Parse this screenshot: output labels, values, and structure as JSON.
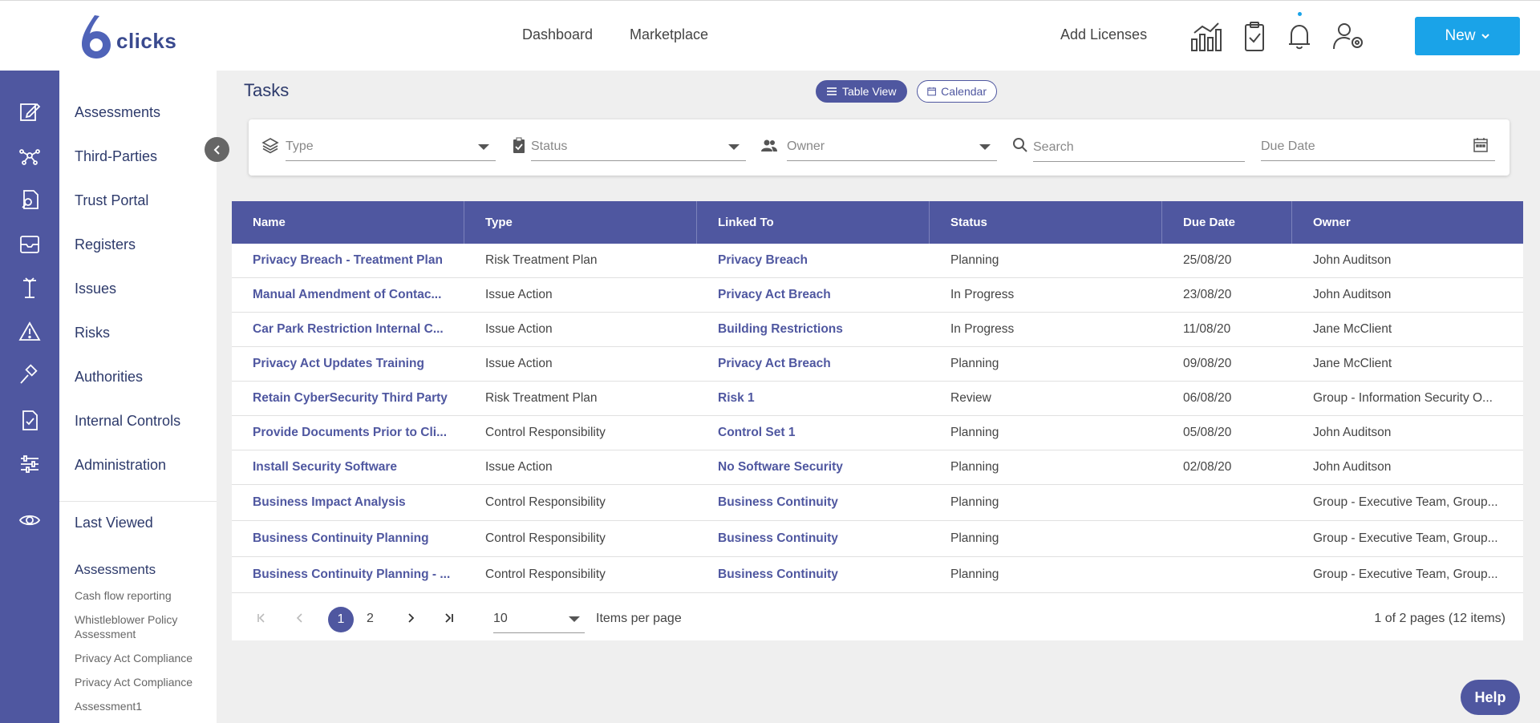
{
  "brand": {
    "logo_text": "clicks"
  },
  "topnav": {
    "dashboard": "Dashboard",
    "marketplace": "Marketplace",
    "add_licenses": "Add Licenses",
    "new_label": "New"
  },
  "colors": {
    "primary": "#4f57a0",
    "accent": "#1aa3e8"
  },
  "rail_icons": [
    "edit-icon",
    "network-icon",
    "file-search-icon",
    "inbox-icon",
    "antenna-icon",
    "warning-icon",
    "gavel-icon",
    "checklist-icon",
    "sliders-icon",
    "eye-icon"
  ],
  "sidebar": {
    "items": [
      "Assessments",
      "Third-Parties",
      "Trust Portal",
      "Registers",
      "Issues",
      "Risks",
      "Authorities",
      "Internal Controls",
      "Administration"
    ],
    "last_viewed": {
      "title": "Last Viewed",
      "section": "Assessments",
      "items": [
        "Cash flow reporting",
        "Whistleblower Policy Assessment",
        "Privacy Act Compliance",
        "Privacy Act Compliance",
        "Assessment1"
      ]
    }
  },
  "page": {
    "title": "Tasks",
    "views": {
      "table": "Table View",
      "calendar": "Calendar"
    }
  },
  "filters": {
    "type": "Type",
    "status": "Status",
    "owner": "Owner",
    "search": "Search",
    "due_date": "Due Date"
  },
  "table": {
    "headers": [
      "Name",
      "Type",
      "Linked To",
      "Status",
      "Due Date",
      "Owner"
    ],
    "rows": [
      [
        "Privacy Breach - Treatment Plan",
        "Risk Treatment Plan",
        "Privacy Breach",
        "Planning",
        "25/08/20",
        "John Auditson"
      ],
      [
        "Manual Amendment of Contac...",
        "Issue Action",
        "Privacy Act Breach",
        "In Progress",
        "23/08/20",
        "John Auditson"
      ],
      [
        "Car Park Restriction Internal C...",
        "Issue Action",
        "Building Restrictions",
        "In Progress",
        "11/08/20",
        "Jane McClient"
      ],
      [
        "Privacy Act Updates Training",
        "Issue Action",
        "Privacy Act Breach",
        "Planning",
        "09/08/20",
        "Jane McClient"
      ],
      [
        "Retain CyberSecurity Third Party",
        "Risk Treatment Plan",
        "Risk 1",
        "Review",
        "06/08/20",
        "Group - Information Security O..."
      ],
      [
        "Provide Documents Prior to Cli...",
        "Control Responsibility",
        "Control Set 1",
        "Planning",
        "05/08/20",
        "John Auditson"
      ],
      [
        "Install Security Software",
        "Issue Action",
        "No Software Security",
        "Planning",
        "02/08/20",
        "John Auditson"
      ],
      [
        "Business Impact Analysis",
        "Control Responsibility",
        "Business Continuity",
        "Planning",
        "",
        "Group - Executive Team, Group..."
      ],
      [
        "Business Continuity Planning",
        "Control Responsibility",
        "Business Continuity",
        "Planning",
        "",
        "Group - Executive Team, Group..."
      ],
      [
        "Business Continuity Planning - ...",
        "Control Responsibility",
        "Business Continuity",
        "Planning",
        "",
        "Group - Executive Team, Group..."
      ]
    ]
  },
  "pager": {
    "pages": [
      "1",
      "2"
    ],
    "current": "1",
    "per_page": "10",
    "per_page_label": "Items per page",
    "info": "1 of 2 pages (12 items)"
  },
  "help": "Help"
}
